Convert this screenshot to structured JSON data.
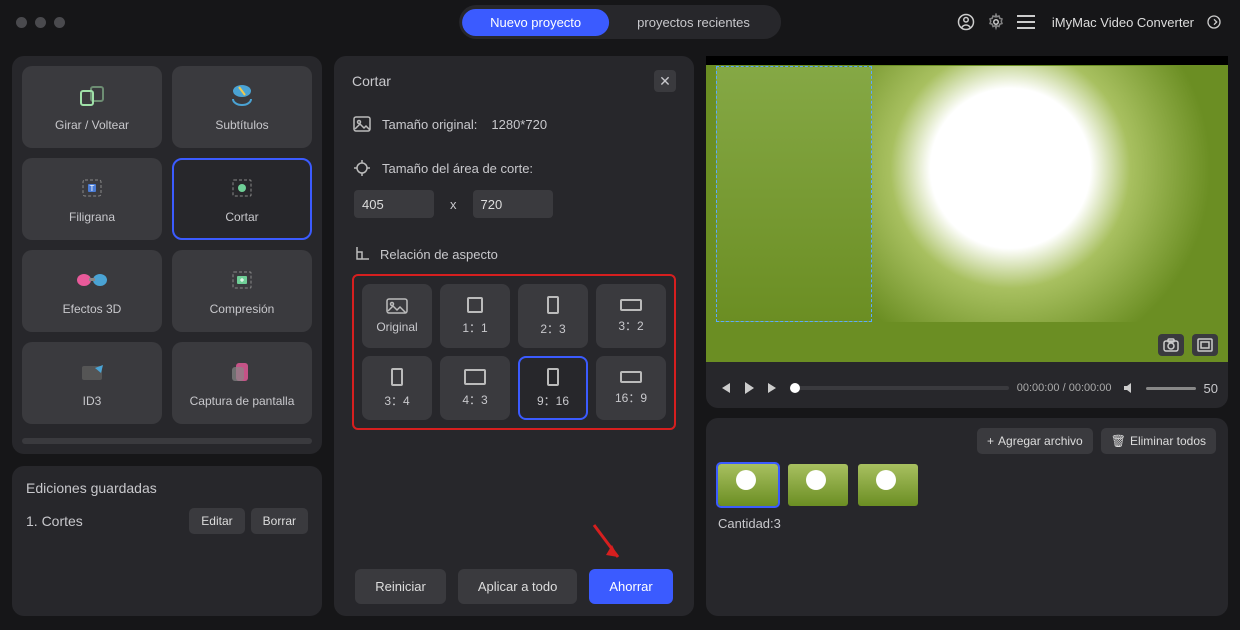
{
  "titlebar": {
    "new_project": "Nuevo proyecto",
    "recent_projects": "proyectos recientes",
    "app_name": "iMyMac Video Converter"
  },
  "sidebar": {
    "tools": [
      {
        "label": "Girar / Voltear",
        "name": "rotate-flip-tool"
      },
      {
        "label": "Subtítulos",
        "name": "subtitles-tool"
      },
      {
        "label": "Filigrana",
        "name": "watermark-tool"
      },
      {
        "label": "Cortar",
        "name": "crop-tool",
        "selected": true
      },
      {
        "label": "Efectos 3D",
        "name": "effects-3d-tool"
      },
      {
        "label": "Compresión",
        "name": "compression-tool"
      },
      {
        "label": "ID3",
        "name": "id3-tool"
      },
      {
        "label": "Captura de pantalla",
        "name": "screenshot-tool"
      }
    ]
  },
  "saved": {
    "title": "Ediciones guardadas",
    "item": "1.  Cortes",
    "edit": "Editar",
    "delete": "Borrar"
  },
  "center": {
    "title": "Cortar",
    "orig_label": "Tamaño original:",
    "orig_value": "1280*720",
    "crop_label": "Tamaño del área de corte:",
    "width": "405",
    "height": "720",
    "dim_sep": "x",
    "ratio_label": "Relación de aspecto",
    "ratios": [
      {
        "label": "Original"
      },
      {
        "label": "1：1"
      },
      {
        "label": "2：3"
      },
      {
        "label": "3：2"
      },
      {
        "label": "3：4"
      },
      {
        "label": "4：3"
      },
      {
        "label": "9：16",
        "selected": true
      },
      {
        "label": "16：9"
      }
    ],
    "reset": "Reiniciar",
    "apply_all": "Aplicar a todo",
    "save": "Ahorrar"
  },
  "preview": {
    "time": "00:00:00 / 00:00:00",
    "volume": "50"
  },
  "playlist": {
    "add": "Agregar archivo",
    "remove_all": "Eliminar todos",
    "count_label": "Cantidad:3"
  }
}
